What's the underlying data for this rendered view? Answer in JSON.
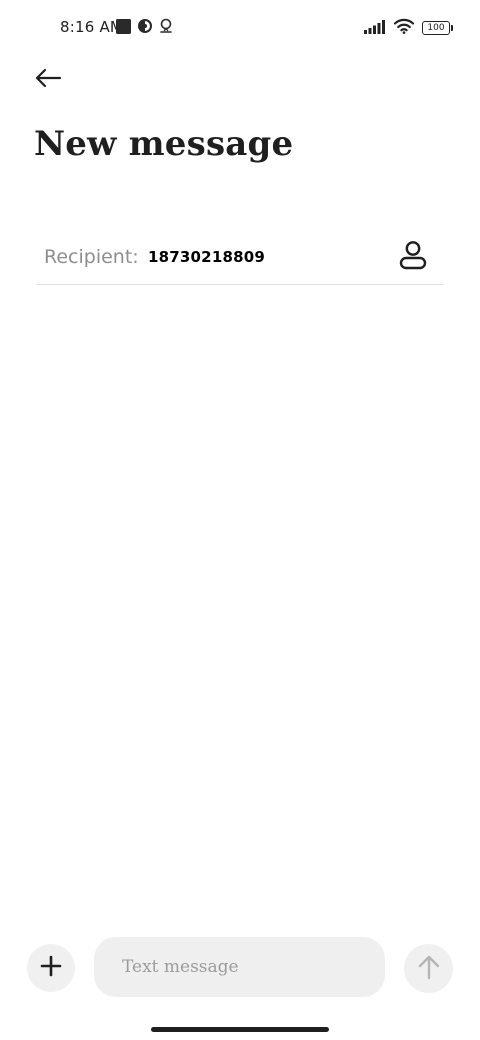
{
  "status_bar": {
    "time": "8:16 AM",
    "left_icons": [
      "notification-square-icon",
      "app-notification-icon",
      "location-icon"
    ],
    "right_icons": [
      "cellular-signal-icon",
      "wifi-icon",
      "battery-icon"
    ],
    "battery_level": "100"
  },
  "header": {
    "back_icon": "arrow-left-icon",
    "title": "New message"
  },
  "recipient": {
    "label": "Recipient:",
    "value": "18730218809",
    "contact_icon": "person-icon"
  },
  "composer": {
    "add_icon": "plus-icon",
    "placeholder": "Text message",
    "value": "",
    "send_icon": "arrow-up-icon",
    "send_enabled": false
  },
  "colors": {
    "background": "#ffffff",
    "text_primary": "#1f1f1f",
    "label_gray": "#8e8e8e",
    "input_background": "#efefef",
    "disabled_icon": "#b5b5b5"
  }
}
